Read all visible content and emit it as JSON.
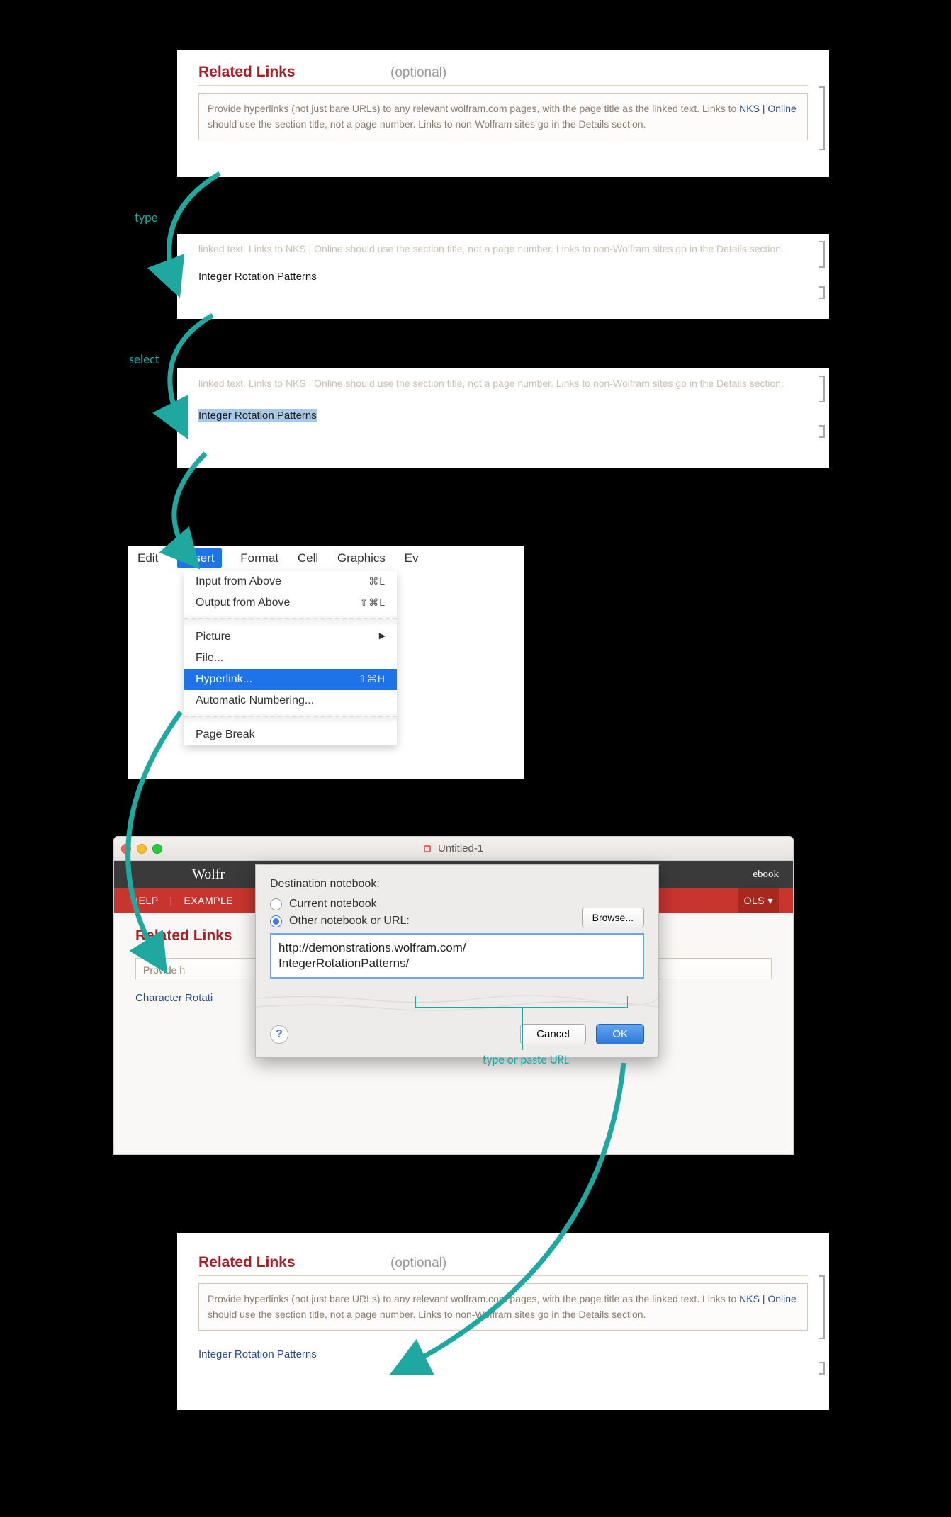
{
  "colors": {
    "accent": "#1fa8a0",
    "title": "#a62027",
    "link": "#2a4a8a"
  },
  "actions": {
    "type": "type",
    "select": "select",
    "url_caption": "type or paste URL"
  },
  "section": {
    "title": "Related Links",
    "optional": "(optional)",
    "help_pre": "Provide hyperlinks (not just bare URLs) to any relevant wolfram.com pages, with the page title as the linked text. Links to ",
    "help_nks": "NKS | Online",
    "help_post": " should use the section title, not a page number. Links to non-Wolfram sites go in the Details section.",
    "help_tail": "linked text. Links to NKS | Online should use the section title, not a page number. Links to non-Wolfram sites go in the Details section.",
    "typed_text": "Integer Rotation Patterns",
    "char_rot": "Character Rotati",
    "provide_frag": "Provide h"
  },
  "menu": {
    "bar": {
      "edit": "Edit",
      "insert": "Insert",
      "format": "Format",
      "cell": "Cell",
      "graphics": "Graphics",
      "ev": "Ev"
    },
    "items": {
      "input_above": "Input from Above",
      "input_above_sc": "⌘L",
      "output_above": "Output from Above",
      "output_above_sc": "⇧⌘L",
      "picture": "Picture",
      "file": "File...",
      "hyperlink": "Hyperlink...",
      "hyperlink_sc": "⇧⌘H",
      "autonum": "Automatic Numbering...",
      "pagebreak": "Page Break"
    }
  },
  "window": {
    "title": "Untitled-1",
    "wolf": "Wolfr",
    "redbar": {
      "help": "HELP",
      "example": "EXAMPLE"
    },
    "ebook_frag": "ebook",
    "ols_frag": "OLS ▾"
  },
  "dialog": {
    "dest_label": "Destination notebook:",
    "opt_current": "Current notebook",
    "opt_other": "Other notebook or URL:",
    "browse": "Browse...",
    "url_l1": "http://demonstrations.wolfram.com/",
    "url_l2": "IntegerRotationPatterns/",
    "cancel": "Cancel",
    "ok": "OK",
    "help": "?"
  }
}
